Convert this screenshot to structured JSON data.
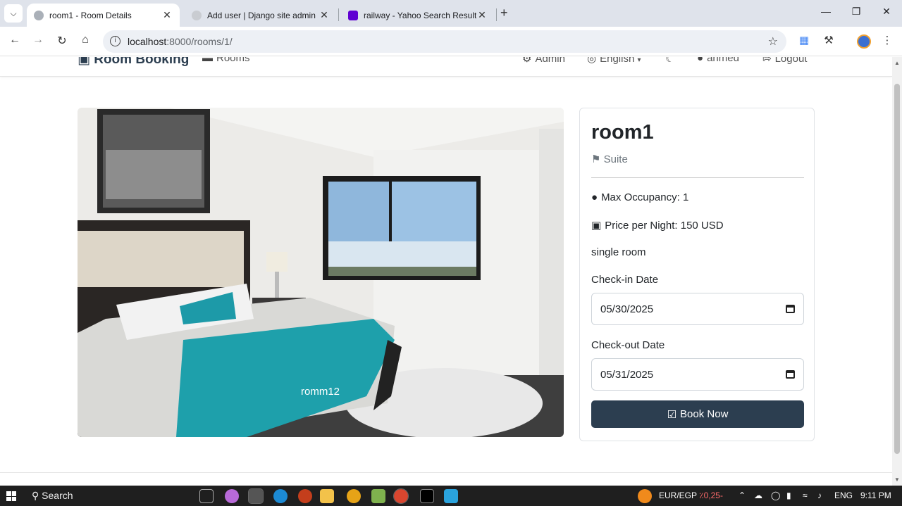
{
  "browser": {
    "tabs": [
      {
        "title": "room1 - Room Details",
        "active": true,
        "favicon": "globe-icon"
      },
      {
        "title": "Add user | Django site admin",
        "active": false,
        "favicon": "globe-icon"
      },
      {
        "title": "railway - Yahoo Search Results",
        "active": false,
        "favicon": "yahoo-icon"
      }
    ],
    "url_host": "localhost",
    "url_path": ":8000/rooms/1/"
  },
  "site_nav": {
    "brand": "Room Booking",
    "rooms": "Rooms",
    "admin": "Admin",
    "language": "English",
    "user": "ahmed",
    "logout": "Logout"
  },
  "room": {
    "image_caption": "romm12",
    "name": "room1",
    "category": "Suite",
    "max_occupancy": "Max Occupancy: 1",
    "price": "Price per Night: 150 USD",
    "description": "single room",
    "checkin_label": "Check-in Date",
    "checkin_value": "05/30/2025",
    "checkout_label": "Check-out Date",
    "checkout_value": "05/31/2025",
    "book_label": "Book Now"
  },
  "taskbar": {
    "search": "Search",
    "fx_pair": "EUR/EGP",
    "fx_change": "٪0,25-",
    "lang": "ENG",
    "time": "9:11 PM"
  },
  "colors": {
    "primary": "#2c3e50",
    "tab_strip": "#dfe3eb"
  }
}
